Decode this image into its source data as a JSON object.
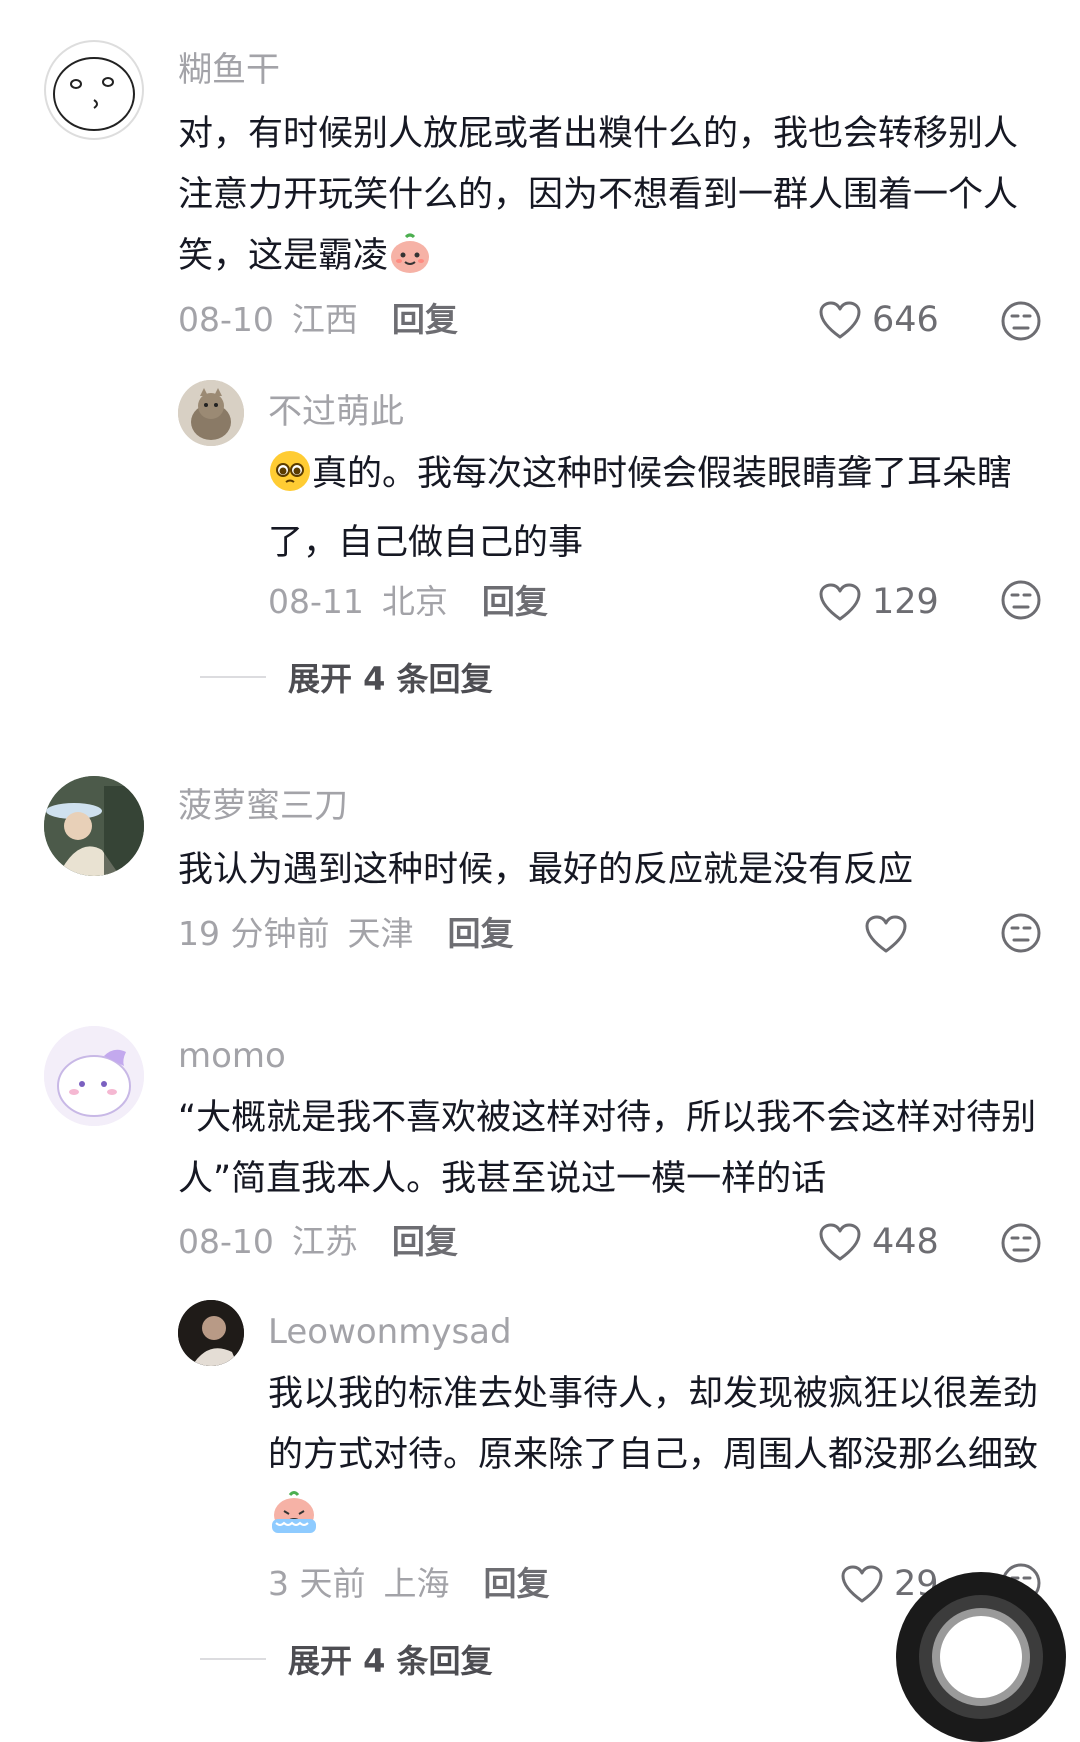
{
  "comments": [
    {
      "username": "糊鱼干",
      "text": "对，有时候别人放屁或者出糗什么的，我也会转移别人注意力开玩笑什么的，因为不想看到一群人围着一个人笑，这是霸凌",
      "date": "08-10",
      "location": "江西",
      "reply_label": "回复",
      "likes": "646"
    },
    {
      "username": "不过萌此",
      "text": "真的。我每次这种时候会假装眼睛聋了耳朵瞎了，自己做自己的事",
      "date": "08-11",
      "location": "北京",
      "reply_label": "回复",
      "likes": "129"
    },
    {
      "username": "菠萝蜜三刀",
      "text": "我认为遇到这种时候，最好的反应就是没有反应",
      "date": "19 分钟前",
      "location": "天津",
      "reply_label": "回复",
      "likes": ""
    },
    {
      "username": "momo",
      "text": "“大概就是我不喜欢被这样对待，所以我不会这样对待别人”简直我本人。我甚至说过一模一样的话",
      "date": "08-10",
      "location": "江苏",
      "reply_label": "回复",
      "likes": "448"
    },
    {
      "username": "Leowonmysad",
      "text": "我以我的标准去处事待人，却发现被疯狂以很差劲的方式对待。原来除了自己，周围人都没那么细致",
      "date": "3 天前",
      "location": "上海",
      "reply_label": "回复",
      "likes": "29"
    }
  ],
  "expand_replies": [
    {
      "label": "展开 4 条回复"
    },
    {
      "label": "展开 4 条回复"
    }
  ],
  "icons": {
    "like": "heart-outline-icon",
    "dislike": "unhappy-face-icon"
  },
  "colors": {
    "text": "#161823",
    "muted": "#a3a3a8",
    "icon": "#6d6d72"
  }
}
